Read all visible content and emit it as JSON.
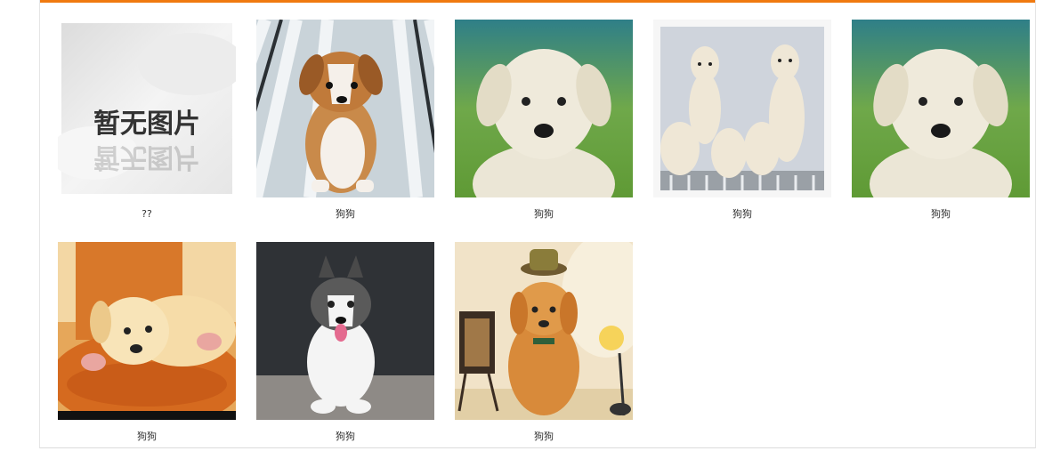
{
  "gallery": {
    "items": [
      {
        "caption": "??",
        "image": "placeholder-no-image",
        "placeholder_text": "暂无图片"
      },
      {
        "caption": "狗狗",
        "image": "corgi-puppy-on-porch"
      },
      {
        "caption": "狗狗",
        "image": "white-labrador-puppy-green-bg"
      },
      {
        "caption": "狗狗",
        "image": "five-labrador-puppies"
      },
      {
        "caption": "狗狗",
        "image": "white-labrador-puppy-green-bg"
      },
      {
        "caption": "狗狗",
        "image": "golden-puppy-on-wood"
      },
      {
        "caption": "狗狗",
        "image": "husky-puppy"
      },
      {
        "caption": "狗狗",
        "image": "golden-puppy-with-hat"
      }
    ]
  },
  "colors": {
    "accent": "#f07a10"
  }
}
